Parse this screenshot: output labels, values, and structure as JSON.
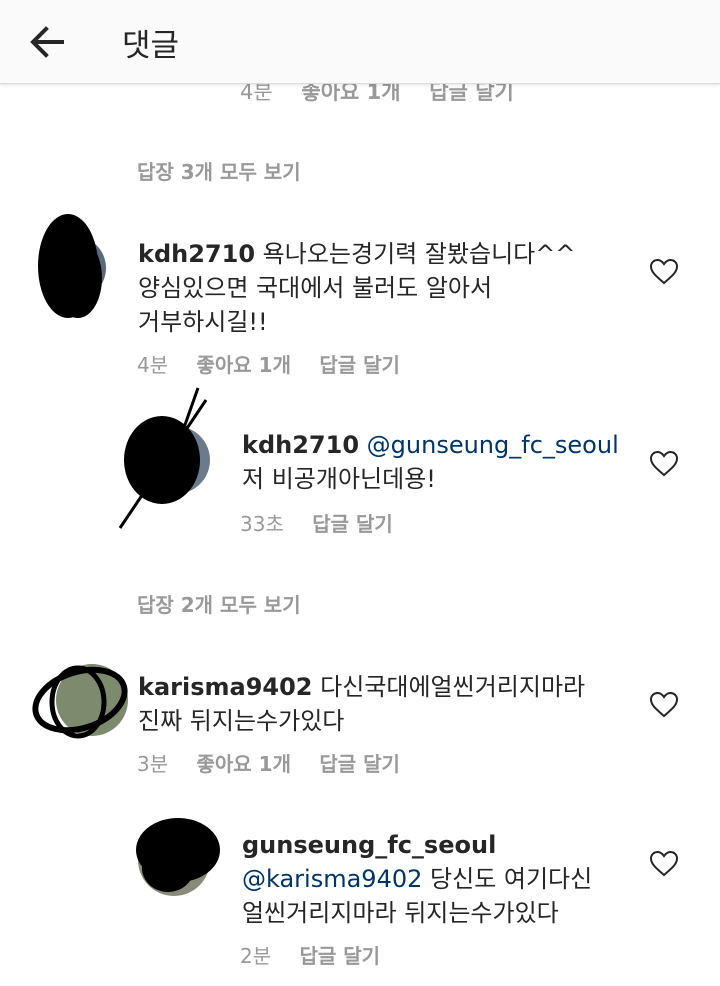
{
  "header": {
    "title": "댓글",
    "back_icon": "arrow-left-icon"
  },
  "partial_previous": {
    "time": "4분",
    "likes": "좋아요 1개",
    "reply": "답글 달기"
  },
  "threads": [
    {
      "view_replies": "답장 3개 모두 보기",
      "comment": {
        "username": "kdh2710",
        "lines": [
          "욕나오는경기력 잘봤습니다^^",
          "양심있으면 국대에서 불러도 알아서",
          "거부하시길!!"
        ],
        "time": "4분",
        "likes": "좋아요 1개",
        "reply": "답글 달기"
      },
      "reply": {
        "username": "kdh2710",
        "mention": "@gunseung_fc_seoul",
        "lines": [
          "저 비공개아닌데용!"
        ],
        "time": "33초",
        "reply": "답글 달기"
      }
    },
    {
      "view_replies": "답장 2개 모두 보기",
      "comment": {
        "username": "karisma9402",
        "first_line_text": "다신국대에얼씬거리지마라",
        "lines": [
          "진짜 뒤지는수가있다"
        ],
        "time": "3분",
        "likes": "좋아요 1개",
        "reply": "답글 달기"
      },
      "reply": {
        "username": "gunseung_fc_seoul",
        "mention": "@karisma9402",
        "mention_text": "당신도 여기다신",
        "lines": [
          "얼씬거리지마라 뒤지는수가있다"
        ],
        "time": "2분",
        "reply": "답글 달기"
      }
    }
  ],
  "colors": {
    "text": "#262626",
    "secondary": "#999999",
    "mention": "#003569",
    "header_bg": "#fafafa"
  }
}
